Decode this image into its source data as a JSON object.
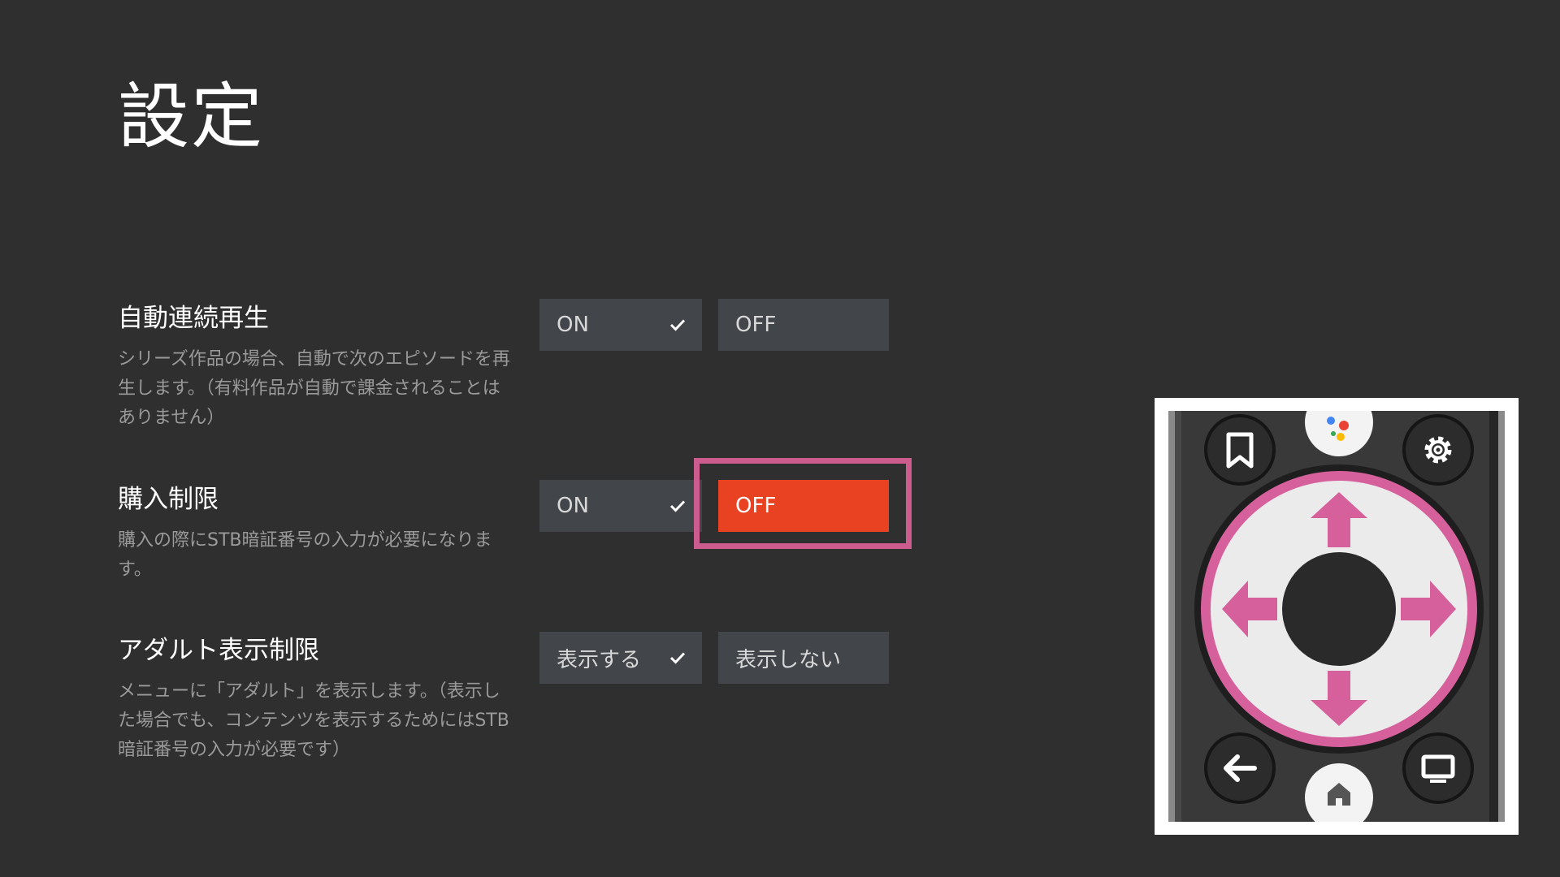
{
  "page": {
    "title": "設定"
  },
  "settings": [
    {
      "title": "自動連続再生",
      "description": "シリーズ作品の場合、自動で次のエピソードを再生します。（有料作品が自動で課金されることはありません）",
      "options": [
        {
          "label": "ON",
          "selected": true
        },
        {
          "label": "OFF",
          "selected": false
        }
      ]
    },
    {
      "title": "購入制限",
      "description": "購入の際にSTB暗証番号の入力が必要になります。",
      "options": [
        {
          "label": "ON",
          "selected": true
        },
        {
          "label": "OFF",
          "selected": false,
          "focused": true
        }
      ]
    },
    {
      "title": "アダルト表示制限",
      "description": "メニューに「アダルト」を表示します。（表示した場合でも、コンテンツを表示するためにはSTB暗証番号の入力が必要です）",
      "options": [
        {
          "label": "表示する",
          "selected": true
        },
        {
          "label": "表示しない",
          "selected": false
        }
      ]
    }
  ],
  "remote": {
    "buttons": [
      "bookmark-icon",
      "assistant-icon",
      "gear-icon",
      "back-arrow-icon",
      "home-icon",
      "tv-icon"
    ],
    "dpad_directions": [
      "up",
      "down",
      "left",
      "right"
    ]
  },
  "colors": {
    "background": "#2f2f30",
    "button": "#42454a",
    "focused_button": "#e84222",
    "focus_frame": "#cc5b8e",
    "dpad_highlight": "#d6609b"
  }
}
